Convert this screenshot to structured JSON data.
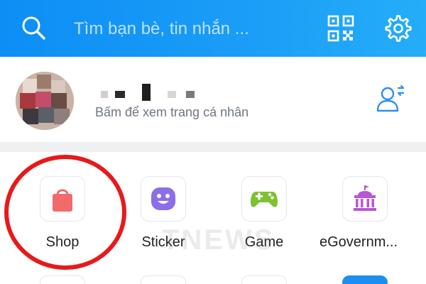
{
  "header": {
    "search_placeholder": "Tìm bạn bè, tin nhắn ...",
    "icons": [
      "search-icon",
      "qr-code-icon",
      "gear-icon"
    ],
    "background_colors": [
      "#0d8ef5",
      "#25adf8"
    ]
  },
  "profile": {
    "subtitle": "Bấm để xem trang cá nhân",
    "icons": [
      "avatar",
      "switch-account-icon"
    ]
  },
  "utilities": [
    {
      "label": "Shop",
      "icon": "shopping-bag-icon",
      "color": "#f26b6b"
    },
    {
      "label": "Sticker",
      "icon": "smiley-icon",
      "color": "#8c6ee8"
    },
    {
      "label": "Game",
      "icon": "gamepad-icon",
      "color": "#7cc232"
    },
    {
      "label": "eGovernm...",
      "icon": "government-building-icon",
      "color": "#b955d6"
    }
  ],
  "highlight": {
    "target": "Shop",
    "color": "#e8191b"
  },
  "watermark": "TNEWS"
}
